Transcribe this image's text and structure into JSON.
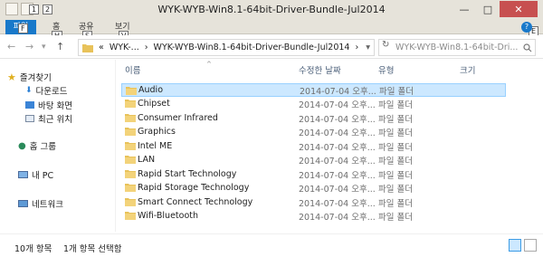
{
  "window": {
    "title": "WYK-WYB-Win8.1-64bit-Driver-Bundle-Jul2014",
    "minimize": "—",
    "maximize": "□",
    "close": "✕"
  },
  "quick_access": {
    "keytip1": "1",
    "keytip2": "2"
  },
  "ribbon": {
    "file_tab": "파일",
    "file_keytip": "F",
    "tabs": [
      {
        "label": "홈",
        "keytip": "H"
      },
      {
        "label": "공유",
        "keytip": "S"
      },
      {
        "label": "보기",
        "keytip": "V"
      }
    ],
    "help_keytip": "E",
    "help_icon": "?"
  },
  "navigation": {
    "back": "←",
    "forward": "→",
    "recent": "▾",
    "up": "↑",
    "breadcrumb_overflow": "«",
    "breadcrumb_parent": "WYK-...",
    "breadcrumb_sep1": "›",
    "breadcrumb_current": "WYK-WYB-Win8.1-64bit-Driver-Bundle-Jul2014",
    "breadcrumb_sep2": "›",
    "dropdown": "▾",
    "refresh": "↻",
    "search_placeholder": "WYK-WYB-Win8.1-64bit-Dri..."
  },
  "sidebar": {
    "favorites": "즐겨찾기",
    "downloads": "다운로드",
    "desktop": "바탕 화면",
    "recent": "최근 위치",
    "homegroup": "홈 그룹",
    "thispc": "내 PC",
    "network": "네트워크"
  },
  "columns": {
    "name": "이름",
    "date": "수정한 날짜",
    "type": "유형",
    "size": "크기",
    "sort_indicator": "^"
  },
  "files": [
    {
      "name": "Audio",
      "date": "2014-07-04 오후...",
      "type": "파일 폴더"
    },
    {
      "name": "Chipset",
      "date": "2014-07-04 오후...",
      "type": "파일 폴더"
    },
    {
      "name": "Consumer Infrared",
      "date": "2014-07-04 오후...",
      "type": "파일 폴더"
    },
    {
      "name": "Graphics",
      "date": "2014-07-04 오후...",
      "type": "파일 폴더"
    },
    {
      "name": "Intel ME",
      "date": "2014-07-04 오후...",
      "type": "파일 폴더"
    },
    {
      "name": "LAN",
      "date": "2014-07-04 오후...",
      "type": "파일 폴더"
    },
    {
      "name": "Rapid Start Technology",
      "date": "2014-07-04 오후...",
      "type": "파일 폴더"
    },
    {
      "name": "Rapid Storage Technology",
      "date": "2014-07-04 오후...",
      "type": "파일 폴더"
    },
    {
      "name": "Smart Connect Technology",
      "date": "2014-07-04 오후...",
      "type": "파일 폴더"
    },
    {
      "name": "Wifi-Bluetooth",
      "date": "2014-07-04 오후...",
      "type": "파일 폴더"
    }
  ],
  "status": {
    "item_count": "10개 항목",
    "selected": "1개 항목 선택함"
  },
  "colors": {
    "file_tab": "#1979ca",
    "selection": "#cce8ff",
    "folder": "#e8c25a",
    "close_button": "#c75050"
  }
}
